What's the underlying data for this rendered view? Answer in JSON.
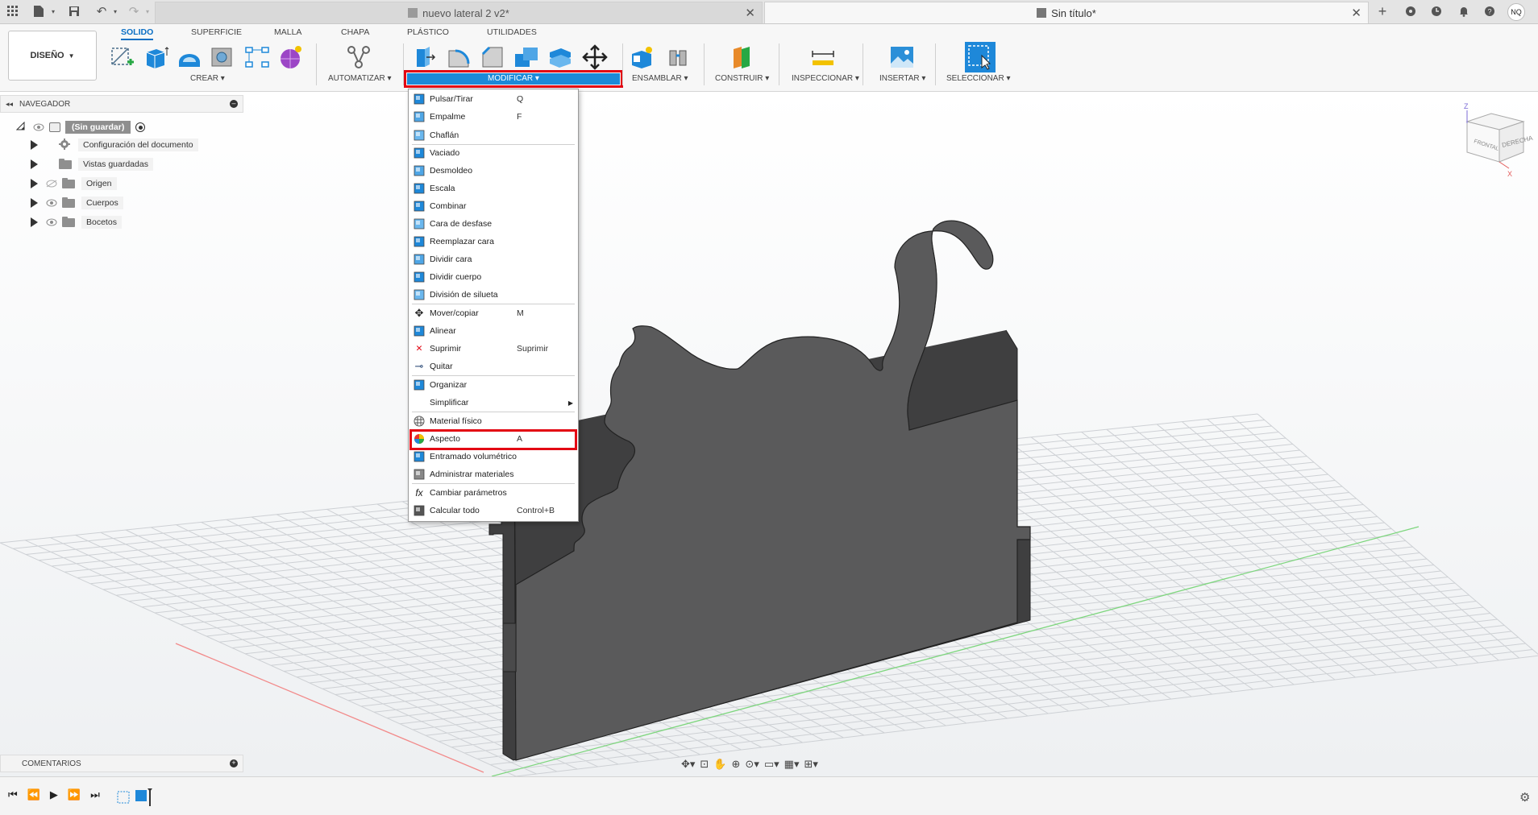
{
  "tabs": [
    {
      "title": "nuevo lateral 2 v2*",
      "active": false
    },
    {
      "title": "Sin título*",
      "active": true
    }
  ],
  "user_initials": "NQ",
  "workspace": {
    "label": "DISEÑO"
  },
  "ribbon_tabs": [
    "SOLIDO",
    "SUPERFICIE",
    "MALLA",
    "CHAPA",
    "PLÁSTICO",
    "UTILIDADES"
  ],
  "ribbon_groups": {
    "crear": "CREAR",
    "automatizar": "AUTOMATIZAR",
    "modificar": "MODIFICAR",
    "ensamblar": "ENSAMBLAR",
    "construir": "CONSTRUIR",
    "inspeccionar": "INSPECCIONAR",
    "insertar": "INSERTAR",
    "seleccionar": "SELECCIONAR"
  },
  "browser": {
    "title": "NAVEGADOR",
    "root": "(Sin guardar)",
    "items": [
      "Configuración del documento",
      "Vistas guardadas",
      "Origen",
      "Cuerpos",
      "Bocetos"
    ]
  },
  "comments": {
    "title": "COMENTARIOS"
  },
  "modify_menu": {
    "items": [
      {
        "label": "Pulsar/Tirar",
        "shortcut": "Q"
      },
      {
        "label": "Empalme",
        "shortcut": "F"
      },
      {
        "label": "Chaflán",
        "shortcut": ""
      },
      {
        "label": "Vaciado",
        "shortcut": ""
      },
      {
        "label": "Desmoldeo",
        "shortcut": ""
      },
      {
        "label": "Escala",
        "shortcut": ""
      },
      {
        "label": "Combinar",
        "shortcut": ""
      },
      {
        "label": "Cara de desfase",
        "shortcut": ""
      },
      {
        "label": "Reemplazar cara",
        "shortcut": ""
      },
      {
        "label": "Dividir cara",
        "shortcut": ""
      },
      {
        "label": "Dividir cuerpo",
        "shortcut": ""
      },
      {
        "label": "División de silueta",
        "shortcut": ""
      },
      {
        "label": "Mover/copiar",
        "shortcut": "M"
      },
      {
        "label": "Alinear",
        "shortcut": ""
      },
      {
        "label": "Suprimir",
        "shortcut": "Suprimir"
      },
      {
        "label": "Quitar",
        "shortcut": ""
      },
      {
        "label": "Organizar",
        "shortcut": ""
      },
      {
        "label": "Simplificar",
        "shortcut": ""
      },
      {
        "label": "Material físico",
        "shortcut": ""
      },
      {
        "label": "Aspecto",
        "shortcut": "A"
      },
      {
        "label": "Entramado volumétrico",
        "shortcut": ""
      },
      {
        "label": "Administrar materiales",
        "shortcut": ""
      },
      {
        "label": "Cambiar parámetros",
        "shortcut": ""
      },
      {
        "label": "Calcular todo",
        "shortcut": "Control+B"
      }
    ]
  },
  "viewcube": {
    "top": "Z",
    "front": "FRONTAL",
    "right": "DERECHA",
    "axis_x": "X"
  },
  "colors": {
    "accent": "#0b6fc4",
    "highlight": "#e30613",
    "body": "#58585a",
    "menu_active": "#1c8ad8"
  }
}
